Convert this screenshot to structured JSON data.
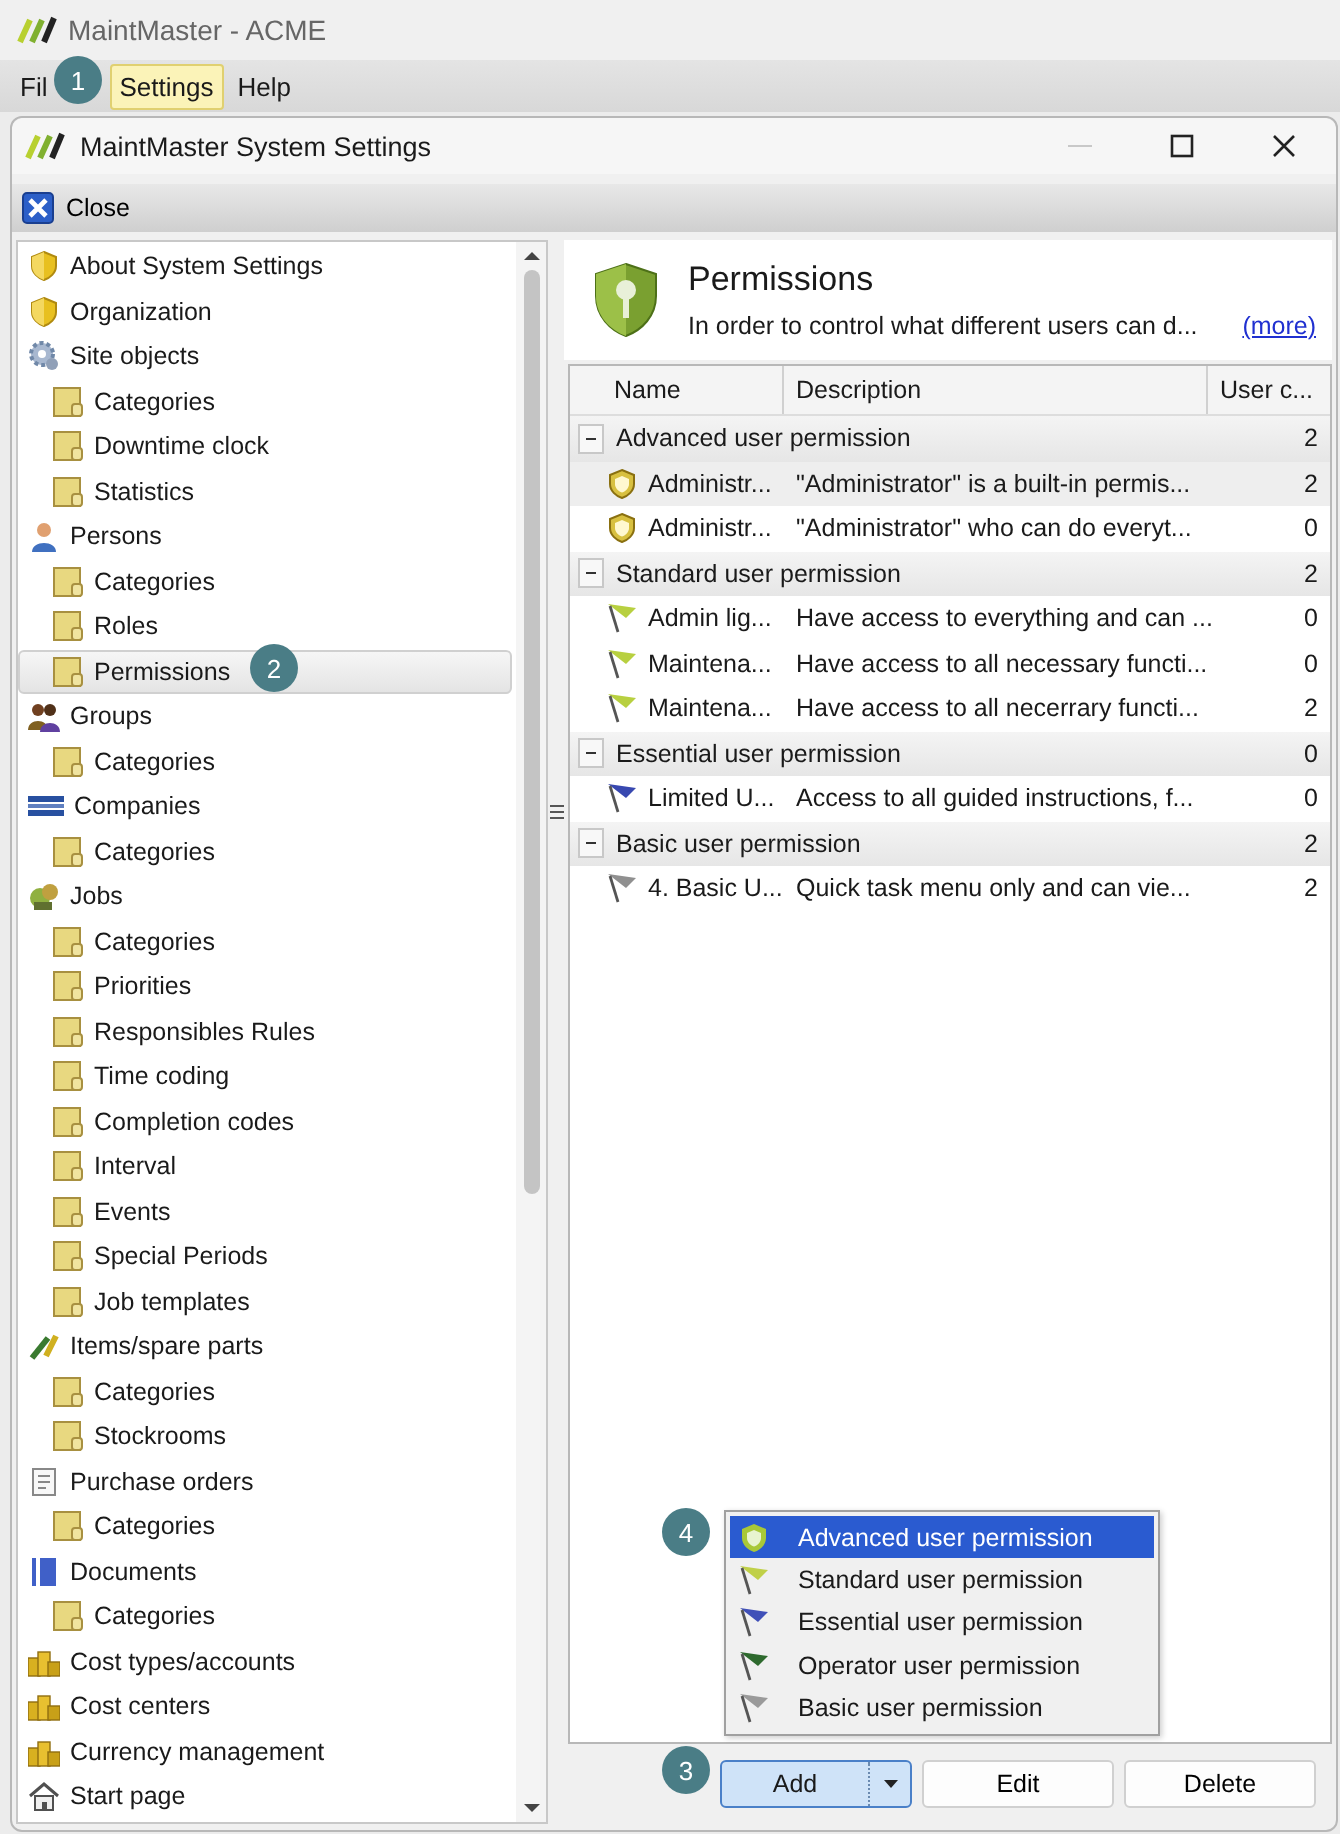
{
  "app": {
    "title": "MaintMaster - ACME",
    "menu": [
      {
        "label": "Fil",
        "selected": false
      },
      {
        "label": "Settings",
        "selected": true
      },
      {
        "label": "Help",
        "selected": false
      }
    ]
  },
  "window": {
    "title": "MaintMaster System Settings",
    "toolbar": [
      "Close"
    ]
  },
  "sidebar": {
    "items": [
      {
        "label": "About System Settings",
        "selected": false
      },
      {
        "label": "Organization",
        "selected": false
      },
      {
        "label": "Site objects",
        "selected": false,
        "children": [
          {
            "label": "Categories",
            "selected": false
          },
          {
            "label": "Downtime clock",
            "selected": false
          },
          {
            "label": "Statistics",
            "selected": false
          }
        ]
      },
      {
        "label": "Persons",
        "selected": false,
        "children": [
          {
            "label": "Categories",
            "selected": false
          },
          {
            "label": "Roles",
            "selected": false
          },
          {
            "label": "Permissions",
            "selected": true
          }
        ]
      },
      {
        "label": "Groups",
        "selected": false,
        "children": [
          {
            "label": "Categories",
            "selected": false
          }
        ]
      },
      {
        "label": "Companies",
        "selected": false,
        "children": [
          {
            "label": "Categories",
            "selected": false
          }
        ]
      },
      {
        "label": "Jobs",
        "selected": false,
        "children": [
          {
            "label": "Categories",
            "selected": false
          },
          {
            "label": "Priorities",
            "selected": false
          },
          {
            "label": "Responsibles Rules",
            "selected": false
          },
          {
            "label": "Time coding",
            "selected": false
          },
          {
            "label": "Completion codes",
            "selected": false
          },
          {
            "label": "Interval",
            "selected": false
          },
          {
            "label": "Events",
            "selected": false
          },
          {
            "label": "Special Periods",
            "selected": false
          },
          {
            "label": "Job templates",
            "selected": false
          }
        ]
      },
      {
        "label": "Items/spare parts",
        "selected": false,
        "children": [
          {
            "label": "Categories",
            "selected": false
          },
          {
            "label": "Stockrooms",
            "selected": false
          }
        ]
      },
      {
        "label": "Purchase orders",
        "selected": false,
        "children": [
          {
            "label": "Categories",
            "selected": false
          }
        ]
      },
      {
        "label": "Documents",
        "selected": false,
        "children": [
          {
            "label": "Categories",
            "selected": false
          }
        ]
      },
      {
        "label": "Cost types/accounts",
        "selected": false
      },
      {
        "label": "Cost centers",
        "selected": false
      },
      {
        "label": "Currency management",
        "selected": false
      },
      {
        "label": "Start page",
        "selected": false
      }
    ]
  },
  "panel": {
    "title": "Permissions",
    "description": "In order to control what different users can d...",
    "link": "(more)"
  },
  "table": {
    "columns": [
      "Name",
      "Description",
      "User c..."
    ],
    "groups": [
      {
        "name": "Advanced user permission",
        "count": "2",
        "expanded": true,
        "rows": [
          {
            "name": "Administr...",
            "description": "\"Administrator\" is a built-in permis...",
            "count": "2",
            "kind": "shield",
            "color": "#d8c040",
            "selected": true
          },
          {
            "name": "Administr...",
            "description": "\"Administrator\" who can do everyt...",
            "count": "0",
            "kind": "shield",
            "color": "#d8c040",
            "selected": false
          }
        ]
      },
      {
        "name": "Standard user permission",
        "count": "2",
        "expanded": true,
        "rows": [
          {
            "name": "Admin lig...",
            "description": "Have access to everything and can ...",
            "count": "0",
            "kind": "flag",
            "color": "#b8d040",
            "selected": false
          },
          {
            "name": "Maintena...",
            "description": "Have access to all necessary functi...",
            "count": "0",
            "kind": "flag",
            "color": "#b8d040",
            "selected": false
          },
          {
            "name": "Maintena...",
            "description": "Have access to all necerrary functi...",
            "count": "2",
            "kind": "flag",
            "color": "#b8d040",
            "selected": false
          }
        ]
      },
      {
        "name": "Essential user permission",
        "count": "0",
        "expanded": true,
        "rows": [
          {
            "name": "Limited U...",
            "description": "Access to all guided instructions, f...",
            "count": "0",
            "kind": "flag",
            "color": "#3848b0",
            "selected": false
          }
        ]
      },
      {
        "name": "Basic user permission",
        "count": "2",
        "expanded": true,
        "rows": [
          {
            "name": "4. Basic U...",
            "description": "Quick task menu only and can vie...",
            "count": "2",
            "kind": "flag",
            "color": "#909090",
            "selected": false
          }
        ]
      }
    ]
  },
  "add_menu": [
    {
      "label": "Advanced user permission",
      "kind": "shield",
      "color": "#a8c838",
      "selected": true
    },
    {
      "label": "Standard user permission",
      "kind": "flag",
      "color": "#c0d048",
      "selected": false
    },
    {
      "label": "Essential user permission",
      "kind": "flag",
      "color": "#4050b8",
      "selected": false
    },
    {
      "label": "Operator user permission",
      "kind": "flag",
      "color": "#2e6a2e",
      "selected": false
    },
    {
      "label": "Basic user permission",
      "kind": "flag",
      "color": "#9a9a9a",
      "selected": false
    }
  ],
  "buttons": [
    {
      "label": "Add",
      "kind": "split"
    },
    {
      "label": "Edit",
      "kind": "plain"
    },
    {
      "label": "Delete",
      "kind": "plain"
    }
  ],
  "callouts": [
    "1",
    "2",
    "3",
    "4"
  ]
}
